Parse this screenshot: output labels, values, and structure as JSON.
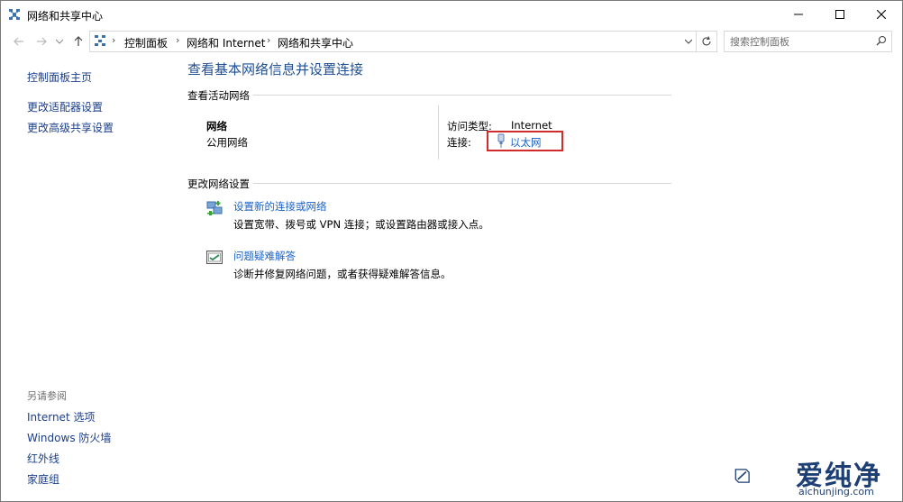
{
  "window": {
    "title": "网络和共享中心",
    "icon": "network-sharing-icon"
  },
  "nav": {
    "back_icon": "arrow-left-icon",
    "forward_icon": "arrow-right-icon",
    "recent_icon": "chevron-down-icon",
    "up_icon": "arrow-up-icon",
    "breadcrumbs": [
      "控制面板",
      "网络和 Internet",
      "网络和共享中心"
    ],
    "refresh_icon": "refresh-icon",
    "search_placeholder": "搜索控制面板"
  },
  "sidebar": {
    "home_link": "控制面板主页",
    "links": [
      "更改适配器设置",
      "更改高级共享设置"
    ],
    "see_also_label": "另请参阅",
    "see_also": [
      "Internet 选项",
      "Windows 防火墙",
      "红外线",
      "家庭组"
    ]
  },
  "main": {
    "title": "查看基本网络信息并设置连接",
    "active_section": "查看活动网络",
    "network_name": "网络",
    "network_type": "公用网络",
    "access_type_label": "访问类型:",
    "access_type_value": "Internet",
    "connections_label": "连接:",
    "connection_link": "以太网",
    "change_section": "更改网络设置",
    "tasks": [
      {
        "link": "设置新的连接或网络",
        "desc": "设置宽带、拨号或 VPN 连接；或设置路由器或接入点。",
        "icon": "new-connection-icon"
      },
      {
        "link": "问题疑难解答",
        "desc": "诊断并修复网络问题，或者获得疑难解答信息。",
        "icon": "troubleshoot-icon"
      }
    ]
  },
  "watermark": {
    "text": "爱纯净",
    "url": "aichunjing.com"
  },
  "colors": {
    "link": "#1a62c8",
    "title": "#1e4e94",
    "highlight": "#d12c2c"
  }
}
